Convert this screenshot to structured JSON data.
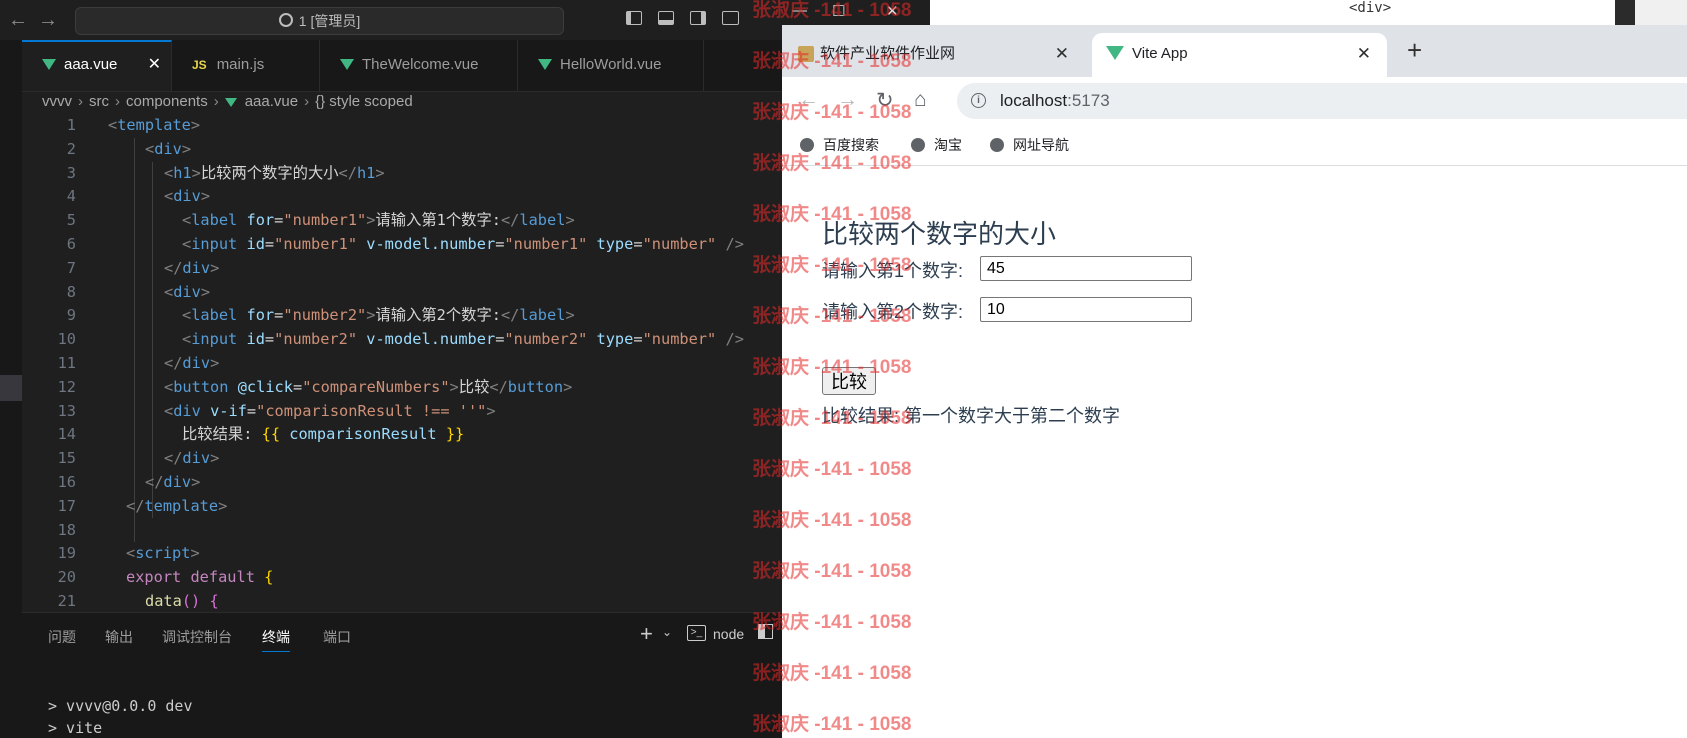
{
  "vscode": {
    "command_center": "1 [管理员]",
    "tabs": [
      {
        "label": "aaa.vue",
        "type": "vue",
        "active": true
      },
      {
        "label": "main.js",
        "type": "js",
        "active": false
      },
      {
        "label": "TheWelcome.vue",
        "type": "vue",
        "active": false
      },
      {
        "label": "HelloWorld.vue",
        "type": "vue",
        "active": false
      }
    ],
    "tab_close": "✕",
    "breadcrumb": {
      "parts": [
        "vvvv",
        "src",
        "components",
        "aaa.vue"
      ],
      "symbol": "{} style scoped"
    },
    "line_numbers": [
      "1",
      "2",
      "3",
      "4",
      "5",
      "6",
      "7",
      "8",
      "9",
      "10",
      "11",
      "12",
      "13",
      "14",
      "15",
      "16",
      "17",
      "18",
      "19",
      "20",
      "21"
    ],
    "code_text": {
      "h1_text": "比较两个数字的大小",
      "label1_text": "请输入第1个数字:",
      "label2_text": "请输入第2个数字:",
      "button_text": "比较",
      "result_text": "比较结果:",
      "number1": "\"number1\"",
      "number2": "\"number2\"",
      "type_number": "\"number\"",
      "compare_fn": "\"compareNumbers\"",
      "vif_expr": "\"comparisonResult !== ''\"",
      "mustache": "comparisonResult"
    },
    "panel": {
      "tabs": [
        "问题",
        "输出",
        "调试控制台",
        "终端",
        "端口"
      ],
      "active_tab": "终端",
      "terminal_label": "node",
      "terminal_lines": [
        "> vvvv@0.0.0 dev",
        "> vite"
      ]
    }
  },
  "browser": {
    "tabs": [
      {
        "label": "软件产业软件作业网",
        "active": false
      },
      {
        "label": "Vite App",
        "active": true
      }
    ],
    "close": "✕",
    "new_tab": "+",
    "url_host": "localhost",
    "url_port": ":5173",
    "bookmarks": [
      "百度搜索",
      "淘宝",
      "网址导航"
    ],
    "page": {
      "heading": "比较两个数字的大小",
      "label1": "请输入第1个数字:",
      "value1": "45",
      "label2": "请输入第2个数字:",
      "value2": "10",
      "button": "比较",
      "result": "比较结果: 第一个数字大于第二个数字"
    }
  },
  "background_window": {
    "code_hint": "<div>"
  },
  "watermark": {
    "text": "张淑庆 -141 - 1058",
    "color": "#e62828"
  }
}
